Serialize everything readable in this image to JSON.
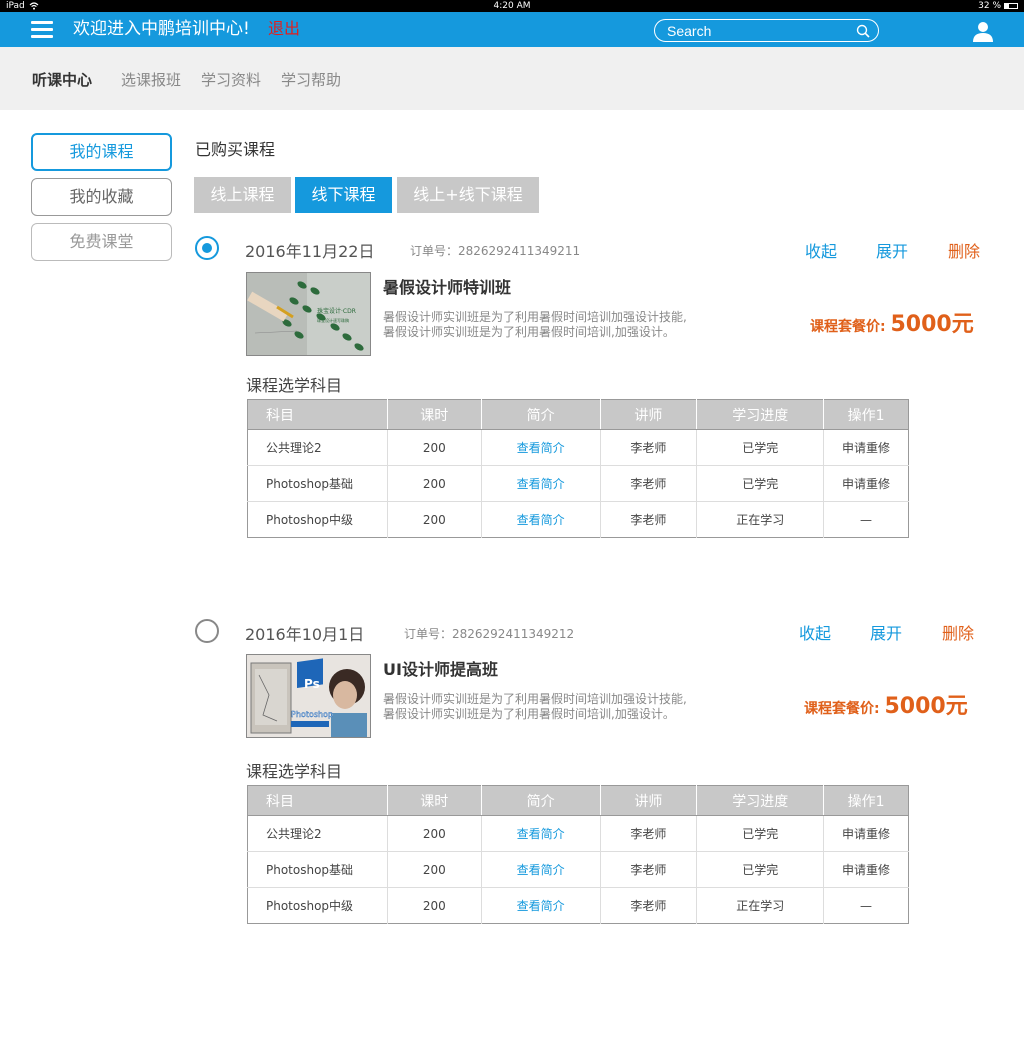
{
  "status": {
    "device": "iPad",
    "time": "4:20 AM",
    "battery": "32 %"
  },
  "header": {
    "welcome": "欢迎进入中鹏培训中心!",
    "logout": "退出",
    "search_placeholder": "Search"
  },
  "nav": [
    "听课中心",
    "选课报班",
    "学习资料",
    "学习帮助"
  ],
  "sidebar": [
    "我的课程",
    "我的收藏",
    "免费课堂"
  ],
  "section_title": "已购买课程",
  "tabs": [
    "线上课程",
    "线下课程",
    "线上+线下课程"
  ],
  "accent": "#1599dd",
  "orders": [
    {
      "date": "2016年11月22日",
      "order_no": "订单号：2826292411349211",
      "actions": [
        "收起",
        "展开",
        "删除"
      ],
      "course_title": "暑假设计师特训班",
      "desc1": "暑假设计师实训班是为了利用暑假时间培训加强设计技能,",
      "desc2": "暑假设计师实训班是为了利用暑假时间培训,加强设计。",
      "price_label": "课程套餐价:",
      "price": "5000元",
      "thumb_text1": "珠宝设计·CDR",
      "thumb_text2": "珠宝设计速写珠稿",
      "subjects_title": "课程选学科目",
      "headers": [
        "科目",
        "课时",
        "简介",
        "讲师",
        "学习进度",
        "操作1"
      ],
      "rows": [
        [
          "公共理论2",
          "200",
          "查看简介",
          "李老师",
          "已学完",
          "申请重修"
        ],
        [
          "Photoshop基础",
          "200",
          "查看简介",
          "李老师",
          "已学完",
          "申请重修"
        ],
        [
          "Photoshop中级",
          "200",
          "查看简介",
          "李老师",
          "正在学习",
          "—"
        ]
      ]
    },
    {
      "date": "2016年10月1日",
      "order_no": "订单号：2826292411349212",
      "actions": [
        "收起",
        "展开",
        "删除"
      ],
      "course_title": "UI设计师提高班",
      "desc1": "暑假设计师实训班是为了利用暑假时间培训加强设计技能,",
      "desc2": "暑假设计师实训班是为了利用暑假时间培训,加强设计。",
      "price_label": "课程套餐价:",
      "price": "5000元",
      "thumb_text1": "Ps",
      "thumb_text2": "Photoshop",
      "subjects_title": "课程选学科目",
      "headers": [
        "科目",
        "课时",
        "简介",
        "讲师",
        "学习进度",
        "操作1"
      ],
      "rows": [
        [
          "公共理论2",
          "200",
          "查看简介",
          "李老师",
          "已学完",
          "申请重修"
        ],
        [
          "Photoshop基础",
          "200",
          "查看简介",
          "李老师",
          "已学完",
          "申请重修"
        ],
        [
          "Photoshop中级",
          "200",
          "查看简介",
          "李老师",
          "正在学习",
          "—"
        ]
      ]
    }
  ]
}
